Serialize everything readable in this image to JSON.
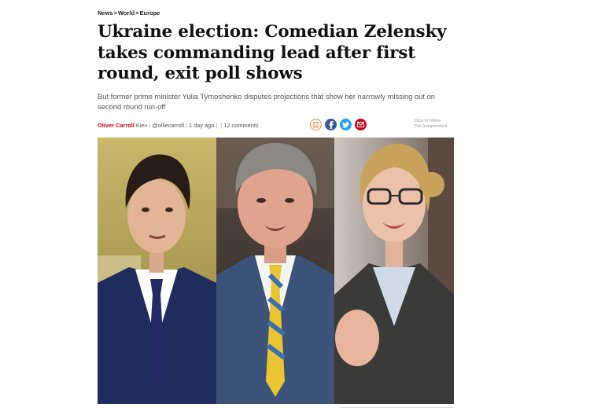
{
  "breadcrumb": {
    "items": [
      "News",
      "World",
      "Europe"
    ],
    "separator": ">"
  },
  "headline": "Ukraine election: Comedian Zelensky takes commanding lead after first round, exit poll shows",
  "standfirst": "But former prime minister Yulia Tymoshenko disputes projections that show her narrowly missing out on second round run-off",
  "byline": {
    "author": "Oliver Carroll",
    "location": "Kiev",
    "twitter": "@olliecarroll",
    "time": "1 day ago",
    "comments": "12 comments"
  },
  "share": {
    "icons": [
      "bookmark-icon",
      "facebook-icon",
      "twitter-icon",
      "email-icon"
    ]
  },
  "follow": {
    "line1": "Click to follow",
    "line2": "The Independent"
  },
  "colors": {
    "author_red": "#d0021b",
    "facebook": "#3b5998",
    "twitter": "#1da1f2",
    "email": "#d0021b",
    "bookmark": "#e08a3c"
  }
}
